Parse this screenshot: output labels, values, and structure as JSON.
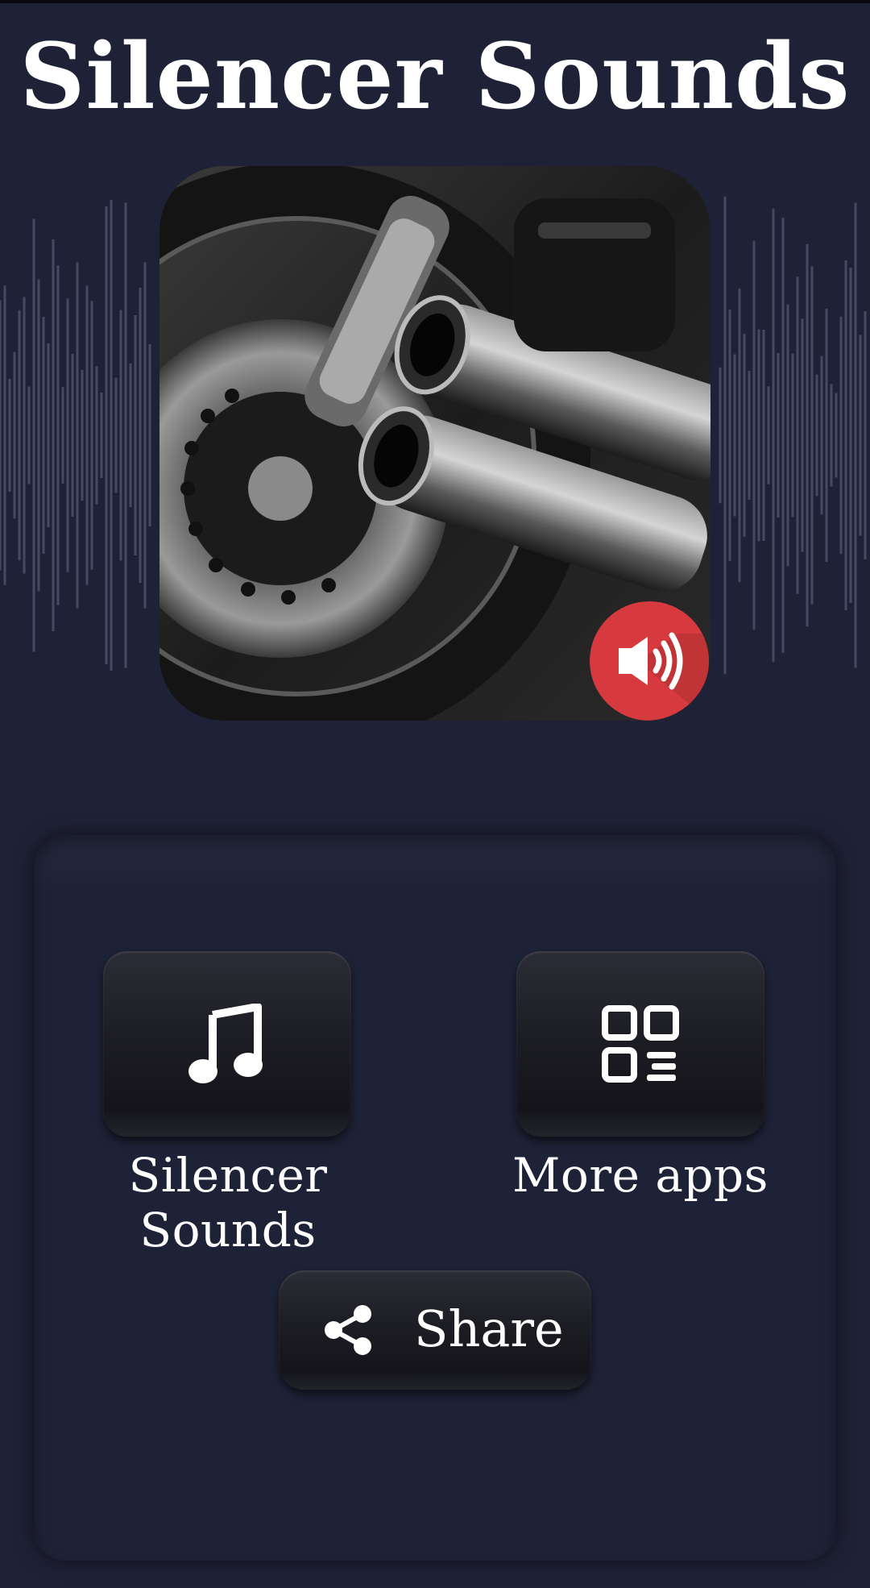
{
  "header": {
    "title": "Silencer Sounds"
  },
  "hero": {
    "image": "motorcycle-exhaust-photo",
    "badge_icon": "speaker-icon",
    "badge_color": "#d63a3e"
  },
  "menu": {
    "tiles": [
      {
        "label": "Silencer Sounds",
        "icon": "music-note-icon"
      },
      {
        "label": "More apps",
        "icon": "app-grid-icon"
      }
    ],
    "share": {
      "label": "Share",
      "icon": "share-icon"
    }
  },
  "colors": {
    "background": "#1f2236",
    "badge": "#d63a3e",
    "text": "#ffffff"
  }
}
